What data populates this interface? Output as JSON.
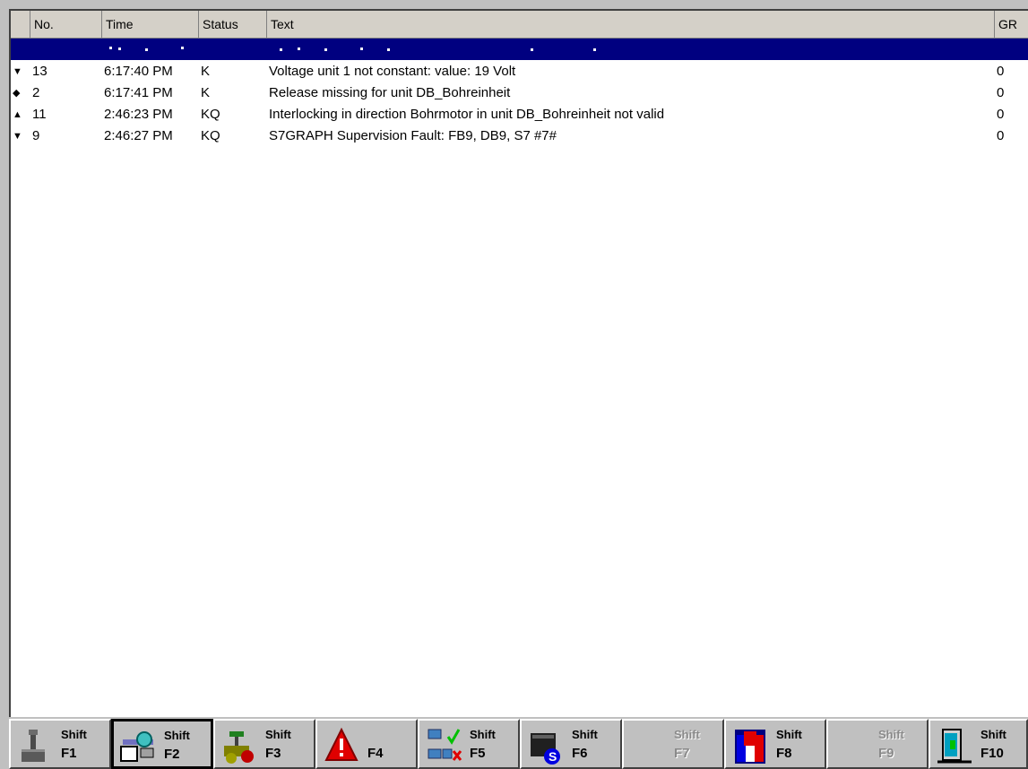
{
  "columns": {
    "no": "No.",
    "time": "Time",
    "status": "Status",
    "text": "Text",
    "gr": "GR"
  },
  "alarms": [
    {
      "marker": "▼",
      "no": "13",
      "time": "6:17:40 PM",
      "status": "K",
      "text": "Voltage unit 1 not constant: value: 19 Volt",
      "gr": "0"
    },
    {
      "marker": "◆",
      "no": "2",
      "time": "6:17:41 PM",
      "status": "K",
      "text": "Release missing for unit DB_Bohreinheit",
      "gr": "0"
    },
    {
      "marker": "▲",
      "no": "11",
      "time": "2:46:23 PM",
      "status": "KQ",
      "text": "Interlocking  in direction Bohrmotor  in unit DB_Bohreinheit not valid",
      "gr": "0"
    },
    {
      "marker": "▼",
      "no": "9",
      "time": "2:46:27 PM",
      "status": "KQ",
      "text": "S7GRAPH Supervision Fault:  FB9, DB9, S7  #7#",
      "gr": "0"
    }
  ],
  "toolbar": {
    "keys": [
      {
        "shift": "Shift",
        "key": "F1",
        "icon": "machine-icon",
        "enabled": true
      },
      {
        "shift": "Shift",
        "key": "F2",
        "icon": "process-view-icon",
        "enabled": true
      },
      {
        "shift": "Shift",
        "key": "F3",
        "icon": "valve-icon",
        "enabled": true
      },
      {
        "shift": "",
        "key": "F4",
        "icon": "alarm-warning-icon",
        "enabled": true
      },
      {
        "shift": "Shift",
        "key": "F5",
        "icon": "network-status-icon",
        "enabled": true
      },
      {
        "shift": "Shift",
        "key": "F6",
        "icon": "s7-icon",
        "enabled": true
      },
      {
        "shift": "Shift",
        "key": "F7",
        "icon": "",
        "enabled": false
      },
      {
        "shift": "Shift",
        "key": "F8",
        "icon": "window-screen-icon",
        "enabled": true
      },
      {
        "shift": "Shift",
        "key": "F9",
        "icon": "",
        "enabled": false
      },
      {
        "shift": "Shift",
        "key": "F10",
        "icon": "exit-door-icon",
        "enabled": true
      }
    ]
  },
  "colors": {
    "selection": "#000080",
    "panel": "#c0c0c0",
    "header": "#d4d0c8"
  }
}
